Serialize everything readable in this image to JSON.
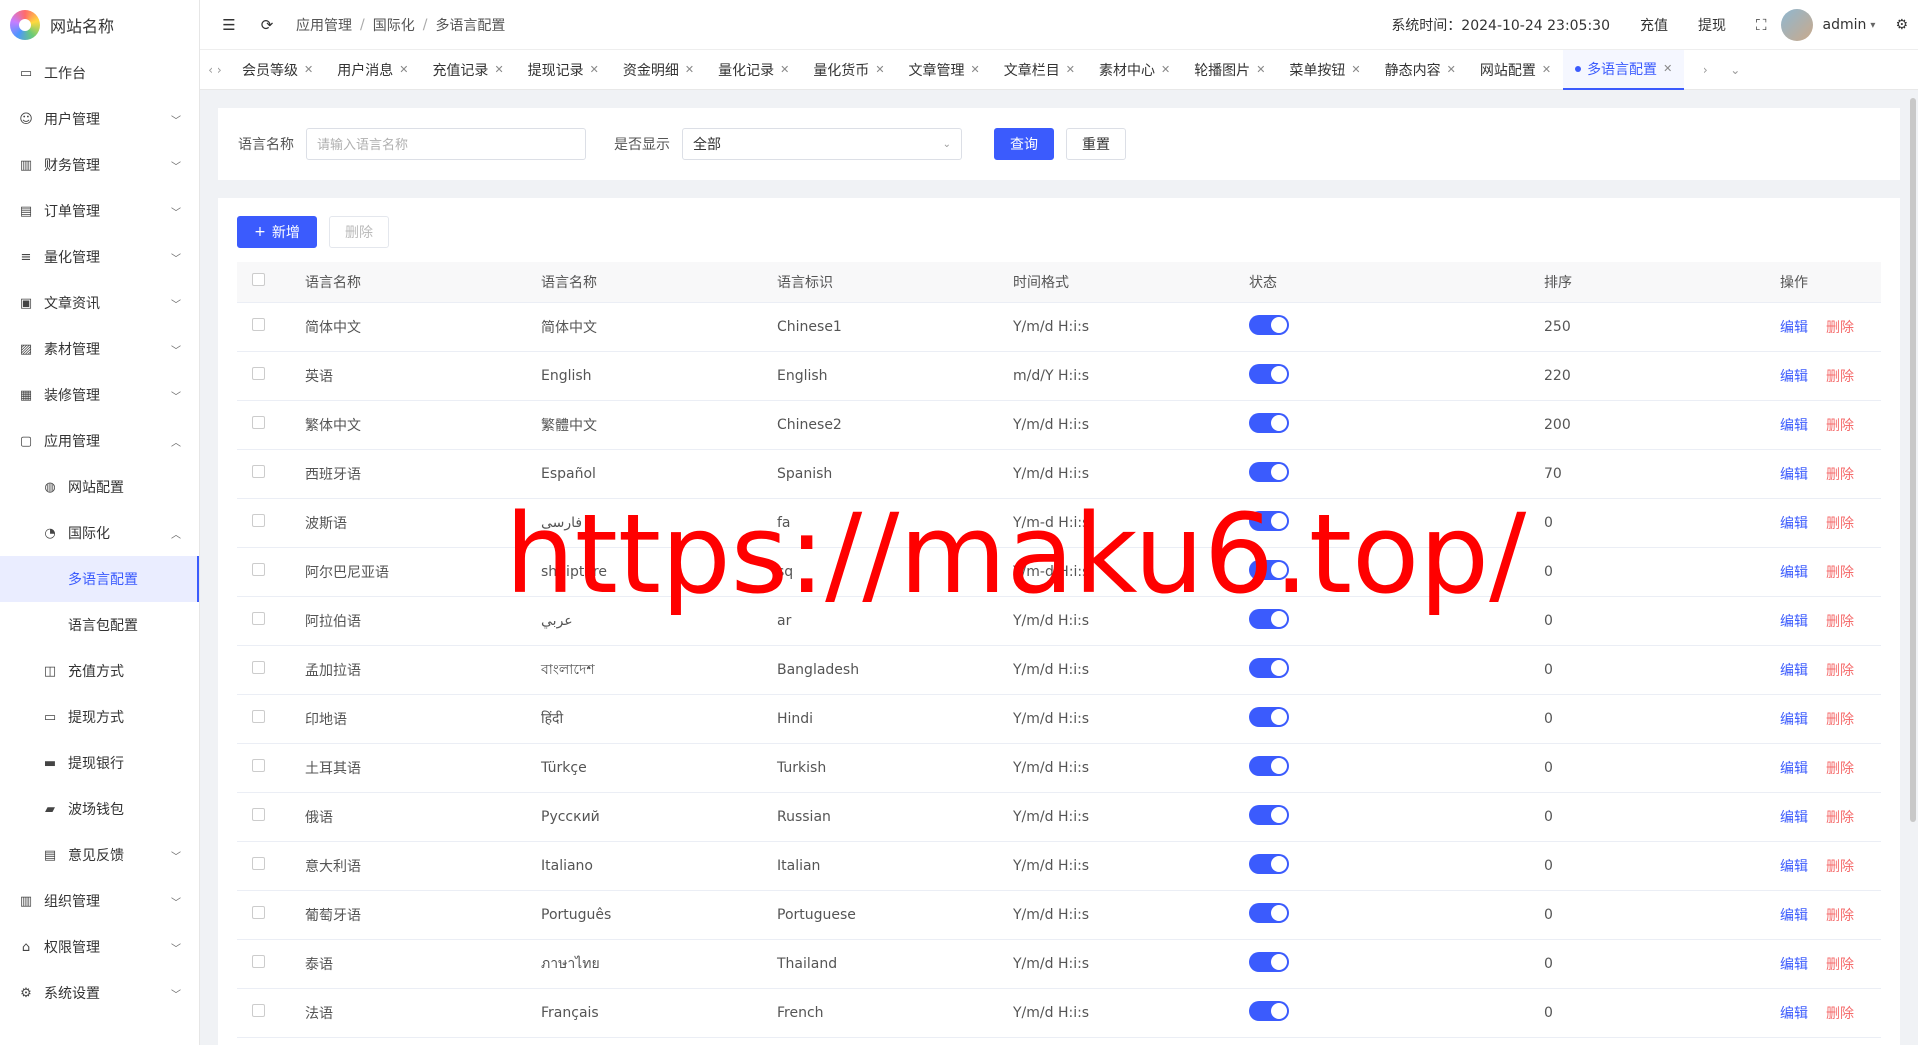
{
  "app": {
    "title": "网站名称"
  },
  "sidebar": {
    "items": [
      {
        "label": "工作台",
        "icon": "monitor-icon"
      },
      {
        "label": "用户管理",
        "icon": "user-icon",
        "expandable": true
      },
      {
        "label": "财务管理",
        "icon": "chart-icon",
        "expandable": true
      },
      {
        "label": "订单管理",
        "icon": "order-icon",
        "expandable": true
      },
      {
        "label": "量化管理",
        "icon": "quant-icon",
        "expandable": true
      },
      {
        "label": "文章资讯",
        "icon": "article-icon",
        "expandable": true
      },
      {
        "label": "素材管理",
        "icon": "image-icon",
        "expandable": true
      },
      {
        "label": "装修管理",
        "icon": "decor-icon",
        "expandable": true
      },
      {
        "label": "应用管理",
        "icon": "app-icon",
        "expanded": true
      }
    ],
    "app_sub": [
      {
        "label": "网站配置",
        "icon": "globe-icon"
      },
      {
        "label": "国际化",
        "icon": "i18n-icon",
        "expanded": true
      }
    ],
    "i18n_sub": [
      {
        "label": "多语言配置",
        "active": true
      },
      {
        "label": "语言包配置"
      }
    ],
    "app_sub2": [
      {
        "label": "充值方式",
        "icon": "wallet-icon"
      },
      {
        "label": "提现方式",
        "icon": "folder-icon"
      },
      {
        "label": "提现银行",
        "icon": "card-icon"
      },
      {
        "label": "波场钱包",
        "icon": "purse-icon"
      },
      {
        "label": "意见反馈",
        "icon": "feedback-icon",
        "expandable": true
      }
    ],
    "bottom_items": [
      {
        "label": "组织管理",
        "icon": "org-icon",
        "expandable": true
      },
      {
        "label": "权限管理",
        "icon": "lock-icon",
        "expandable": true
      },
      {
        "label": "系统设置",
        "icon": "gear-icon",
        "expandable": true
      }
    ]
  },
  "header": {
    "breadcrumb": [
      "应用管理",
      "国际化",
      "多语言配置"
    ],
    "system_time_label": "系统时间：2024-10-24 23:05:30",
    "recharge": "充值",
    "withdraw": "提现",
    "username": "admin"
  },
  "tabs": [
    {
      "label": "会员等级"
    },
    {
      "label": "用户消息"
    },
    {
      "label": "充值记录"
    },
    {
      "label": "提现记录"
    },
    {
      "label": "资金明细"
    },
    {
      "label": "量化记录"
    },
    {
      "label": "量化货币"
    },
    {
      "label": "文章管理"
    },
    {
      "label": "文章栏目"
    },
    {
      "label": "素材中心"
    },
    {
      "label": "轮播图片"
    },
    {
      "label": "菜单按钮"
    },
    {
      "label": "静态内容"
    },
    {
      "label": "网站配置"
    },
    {
      "label": "多语言配置",
      "active": true
    }
  ],
  "search": {
    "name_label": "语言名称",
    "name_placeholder": "请输入语言名称",
    "show_label": "是否显示",
    "show_value": "全部",
    "query_btn": "查询",
    "reset_btn": "重置"
  },
  "toolbar": {
    "add_btn": "新增",
    "delete_btn": "删除"
  },
  "table": {
    "headers": [
      "语言名称",
      "语言名称",
      "语言标识",
      "时间格式",
      "状态",
      "排序",
      "操作"
    ],
    "edit_label": "编辑",
    "delete_label": "删除",
    "rows": [
      {
        "name": "简体中文",
        "native": "简体中文",
        "code": "Chinese1",
        "fmt": "Y/m/d H:i:s",
        "sort": "250",
        "enabled": true
      },
      {
        "name": "英语",
        "native": "English",
        "code": "English",
        "fmt": "m/d/Y H:i:s",
        "sort": "220",
        "enabled": true
      },
      {
        "name": "繁体中文",
        "native": "繁體中文",
        "code": "Chinese2",
        "fmt": "Y/m/d H:i:s",
        "sort": "200",
        "enabled": true
      },
      {
        "name": "西班牙语",
        "native": "Español",
        "code": "Spanish",
        "fmt": "Y/m/d H:i:s",
        "sort": "70",
        "enabled": true
      },
      {
        "name": "波斯语",
        "native": "فارسی",
        "code": "fa",
        "fmt": "Y/m-d H:i:s",
        "sort": "0",
        "enabled": true
      },
      {
        "name": "阿尔巴尼亚语",
        "native": "shqiptare",
        "code": "sq",
        "fmt": "Y/m-d H:i:s",
        "sort": "0",
        "enabled": true
      },
      {
        "name": "阿拉伯语",
        "native": "عربي",
        "code": "ar",
        "fmt": "Y/m/d H:i:s",
        "sort": "0",
        "enabled": true
      },
      {
        "name": "孟加拉语",
        "native": "বাংলাদেশ",
        "code": "Bangladesh",
        "fmt": "Y/m/d H:i:s",
        "sort": "0",
        "enabled": true
      },
      {
        "name": "印地语",
        "native": "हिंदी",
        "code": "Hindi",
        "fmt": "Y/m/d H:i:s",
        "sort": "0",
        "enabled": true
      },
      {
        "name": "土耳其语",
        "native": "Türkçe",
        "code": "Turkish",
        "fmt": "Y/m/d H:i:s",
        "sort": "0",
        "enabled": true
      },
      {
        "name": "俄语",
        "native": "Русский",
        "code": "Russian",
        "fmt": "Y/m/d H:i:s",
        "sort": "0",
        "enabled": true
      },
      {
        "name": "意大利语",
        "native": "Italiano",
        "code": "Italian",
        "fmt": "Y/m/d H:i:s",
        "sort": "0",
        "enabled": true
      },
      {
        "name": "葡萄牙语",
        "native": "Português",
        "code": "Portuguese",
        "fmt": "Y/m/d H:i:s",
        "sort": "0",
        "enabled": true
      },
      {
        "name": "泰语",
        "native": "ภาษาไทย",
        "code": "Thailand",
        "fmt": "Y/m/d H:i:s",
        "sort": "0",
        "enabled": true
      },
      {
        "name": "法语",
        "native": "Français",
        "code": "French",
        "fmt": "Y/m/d H:i:s",
        "sort": "0",
        "enabled": true
      }
    ]
  },
  "watermark": "https://maku6.top/",
  "colors": {
    "accent": "#3b5bfd",
    "danger": "#f56c6c",
    "watermark": "#ff0000"
  }
}
